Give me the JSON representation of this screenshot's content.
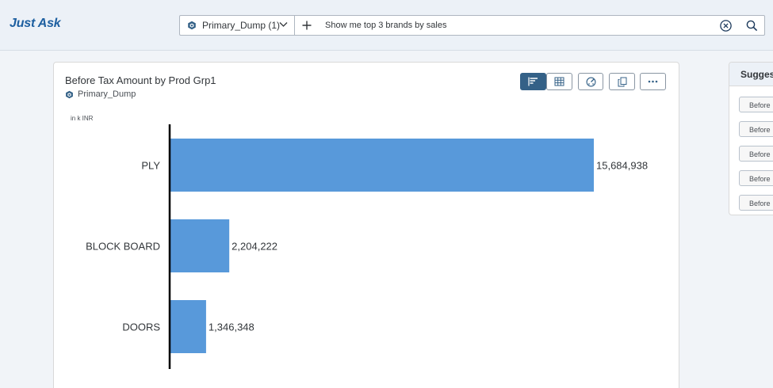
{
  "app": {
    "title": "Just Ask"
  },
  "search": {
    "model_label": "Primary_Dump (1)",
    "query": "Show me top 3 brands by sales"
  },
  "card": {
    "title": "Before Tax Amount by Prod Grp1",
    "source": "Primary_Dump",
    "unit_label": "in k INR",
    "toolbar": [
      "bar-chart-icon",
      "table-icon",
      "chart-type-icon",
      "copy-icon",
      "more-icon"
    ]
  },
  "chart_data": {
    "type": "bar",
    "orientation": "horizontal",
    "categories": [
      "PLY",
      "BLOCK BOARD",
      "DOORS"
    ],
    "values": [
      15684938,
      2204222,
      1346348
    ],
    "value_labels": [
      "15,684,938",
      "2,204,222",
      "1,346,348"
    ],
    "unit": "in k INR",
    "bar_color": "#5899da",
    "grid": false
  },
  "suggestions": {
    "header": "Suggest",
    "items": [
      "Before",
      "Before",
      "Before",
      "Before",
      "Before"
    ]
  }
}
